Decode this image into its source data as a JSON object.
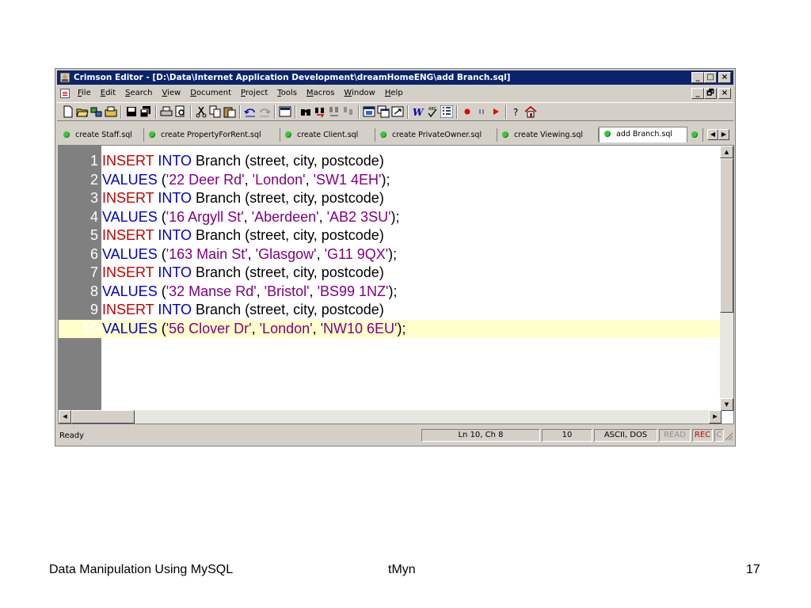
{
  "window": {
    "title": "Crimson Editor - [D:\\Data\\Internet Application Development\\dreamHomeENG\\add Branch.sql]",
    "caption_buttons": [
      "_",
      "□",
      "×"
    ],
    "mdi_buttons": [
      "_",
      "🗗",
      "×"
    ]
  },
  "menu": [
    "File",
    "Edit",
    "Search",
    "View",
    "Document",
    "Project",
    "Tools",
    "Macros",
    "Window",
    "Help"
  ],
  "toolbar_icons": [
    "new-file-icon",
    "open-file-icon",
    "open-remote-icon",
    "project-icon",
    "save-icon",
    "save-all-icon",
    "print-icon",
    "print-preview-icon",
    "cut-icon",
    "copy-icon",
    "paste-icon",
    "undo-icon",
    "redo-icon",
    "column-mode-icon",
    "find-icon",
    "find-next-icon",
    "replace-icon",
    "goto-icon",
    "window-icon",
    "window-cascade-icon",
    "fullscreen-icon",
    "word-wrap-icon",
    "spell-check-icon",
    "line-numbers-icon",
    "record-macro-icon",
    "pause-macro-icon",
    "play-macro-icon",
    "help-icon",
    "home-icon"
  ],
  "tabs": [
    {
      "label": "create Staff.sql",
      "active": false
    },
    {
      "label": "create PropertyForRent.sql",
      "active": false
    },
    {
      "label": "create Client.sql",
      "active": false
    },
    {
      "label": "create PrivateOwner.sql",
      "active": false
    },
    {
      "label": "create Viewing.sql",
      "active": false
    },
    {
      "label": "add Branch.sql",
      "active": true
    }
  ],
  "editor": {
    "lines": [
      {
        "n": "1",
        "tokens": [
          [
            "k1",
            "INSERT"
          ],
          [
            "p",
            " "
          ],
          [
            "k2",
            "INTO"
          ],
          [
            "p",
            " Branch (street, city, postcode)"
          ]
        ]
      },
      {
        "n": "2",
        "tokens": [
          [
            "k2",
            "VALUES"
          ],
          [
            "p",
            " ("
          ],
          [
            "s",
            "'22 Deer Rd'"
          ],
          [
            "p",
            ", "
          ],
          [
            "s",
            "'London'"
          ],
          [
            "p",
            ", "
          ],
          [
            "s",
            "'SW1 4EH'"
          ],
          [
            "p",
            ");"
          ]
        ]
      },
      {
        "n": "3",
        "tokens": [
          [
            "k1",
            "INSERT"
          ],
          [
            "p",
            " "
          ],
          [
            "k2",
            "INTO"
          ],
          [
            "p",
            " Branch (street, city, postcode)"
          ]
        ]
      },
      {
        "n": "4",
        "tokens": [
          [
            "k2",
            "VALUES"
          ],
          [
            "p",
            " ("
          ],
          [
            "s",
            "'16 Argyll St'"
          ],
          [
            "p",
            ", "
          ],
          [
            "s",
            "'Aberdeen'"
          ],
          [
            "p",
            ", "
          ],
          [
            "s",
            "'AB2 3SU'"
          ],
          [
            "p",
            ");"
          ]
        ]
      },
      {
        "n": "5",
        "tokens": [
          [
            "k1",
            "INSERT"
          ],
          [
            "p",
            " "
          ],
          [
            "k2",
            "INTO"
          ],
          [
            "p",
            " Branch (street, city, postcode)"
          ]
        ]
      },
      {
        "n": "6",
        "tokens": [
          [
            "k2",
            "VALUES"
          ],
          [
            "p",
            " ("
          ],
          [
            "s",
            "'163 Main St'"
          ],
          [
            "p",
            ", "
          ],
          [
            "s",
            "'Glasgow'"
          ],
          [
            "p",
            ", "
          ],
          [
            "s",
            "'G11 9QX'"
          ],
          [
            "p",
            ");"
          ]
        ]
      },
      {
        "n": "7",
        "tokens": [
          [
            "k1",
            "INSERT"
          ],
          [
            "p",
            " "
          ],
          [
            "k2",
            "INTO"
          ],
          [
            "p",
            " Branch (street, city, postcode)"
          ]
        ]
      },
      {
        "n": "8",
        "tokens": [
          [
            "k2",
            "VALUES"
          ],
          [
            "p",
            " ("
          ],
          [
            "s",
            "'32 Manse Rd'"
          ],
          [
            "p",
            ", "
          ],
          [
            "s",
            "'Bristol'"
          ],
          [
            "p",
            ", "
          ],
          [
            "s",
            "'BS99 1NZ'"
          ],
          [
            "p",
            ");"
          ]
        ]
      },
      {
        "n": "9",
        "tokens": [
          [
            "k1",
            "INSERT"
          ],
          [
            "p",
            " "
          ],
          [
            "k2",
            "INTO"
          ],
          [
            "p",
            " Branch (street, city, postcode)"
          ]
        ]
      },
      {
        "n": "10",
        "tokens": [
          [
            "k2",
            "VALUES"
          ],
          [
            "p",
            " ("
          ],
          [
            "s",
            "'56 Clover Dr'"
          ],
          [
            "p",
            ", "
          ],
          [
            "s",
            "'London'"
          ],
          [
            "p",
            ", "
          ],
          [
            "s",
            "'NW10 6EU'"
          ],
          [
            "p",
            ");"
          ]
        ]
      }
    ],
    "current_line": 10
  },
  "status": {
    "ready": "Ready",
    "position": "Ln 10, Ch 8",
    "total_lines": "10",
    "encoding": "ASCII, DOS",
    "read": "READ",
    "rec": "REC",
    "col": "C"
  },
  "footer": {
    "left": "Data Manipulation Using MySQL",
    "center": "tMyn",
    "page": "17"
  },
  "colors": {
    "title_bar": "#0a246a",
    "keyword_red": "#c00000",
    "keyword_blue": "#0000c0",
    "string": "#800080",
    "current_line": "#ffffcc",
    "gutter": "#808080"
  }
}
